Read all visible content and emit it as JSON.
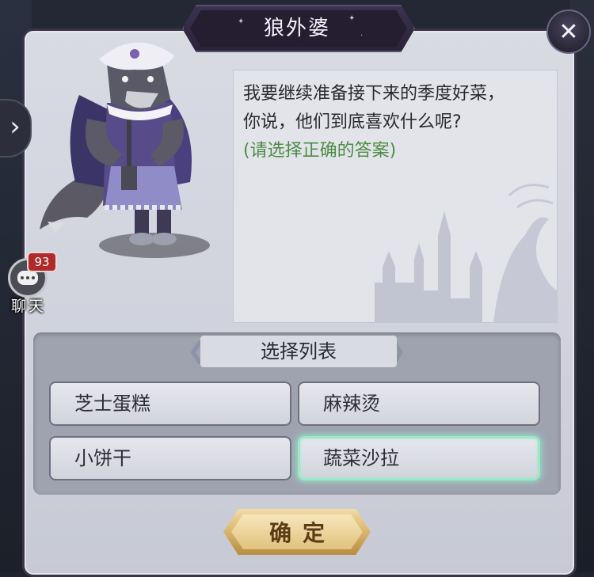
{
  "dialog": {
    "title": "狼外婆"
  },
  "npc": {
    "name": "狼外婆",
    "dialogue_line1": "我要继续准备接下来的季度好菜，",
    "dialogue_line2": "你说，他们到底喜欢什么呢?",
    "hint": "(请选择正确的答案)"
  },
  "choice_list": {
    "header": "选择列表",
    "options": [
      {
        "label": "芝士蛋糕",
        "selected": false
      },
      {
        "label": "麻辣烫",
        "selected": false
      },
      {
        "label": "小饼干",
        "selected": false
      },
      {
        "label": "蔬菜沙拉",
        "selected": true
      }
    ],
    "confirm_label": "确定"
  },
  "chat": {
    "label": "聊天",
    "unread_count": "93"
  },
  "icons": {
    "close": "close-icon",
    "expand_sidebar": "chevron-right-icon",
    "chat": "chat-bubble-icon"
  },
  "colors": {
    "selected_glow": "#9be8c8",
    "hint_green": "#4c8c45",
    "badge_red": "#b02a2a",
    "confirm_gold": "#d8b56c"
  }
}
